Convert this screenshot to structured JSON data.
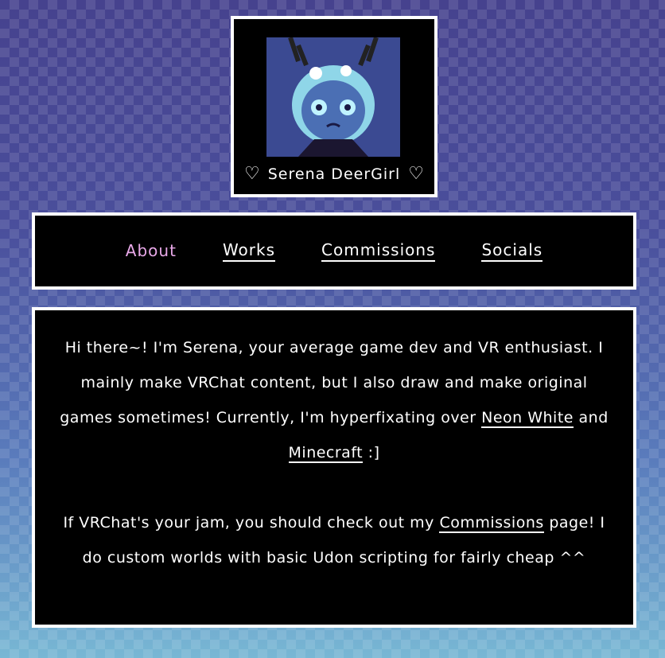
{
  "header": {
    "name": "Serena DeerGirl",
    "heart_left": "♡",
    "heart_right": "♡",
    "avatar_alt": "avatar-icon"
  },
  "nav": {
    "items": [
      {
        "label": "About",
        "active": true
      },
      {
        "label": "Works",
        "active": false
      },
      {
        "label": "Commissions",
        "active": false
      },
      {
        "label": "Socials",
        "active": false
      }
    ]
  },
  "content": {
    "p1_before": "Hi there~! I'm Serena, your average game dev and VR enthusiast. I mainly make VRChat content, but I also draw and make original games sometimes! Currently, I'm hyperfixating over ",
    "link_neon": "Neon White",
    "p1_and": " and ",
    "link_minecraft": "Minecraft",
    "p1_after": " :]",
    "p2_before": "If VRChat's your jam, you should check out my ",
    "link_commissions": "Commissions",
    "p2_after": " page! I do custom worlds with basic Udon scripting for fairly cheap ^^"
  },
  "colors": {
    "accent_active": "#e8a8e8",
    "panel_bg": "#000000",
    "border": "#ffffff"
  }
}
